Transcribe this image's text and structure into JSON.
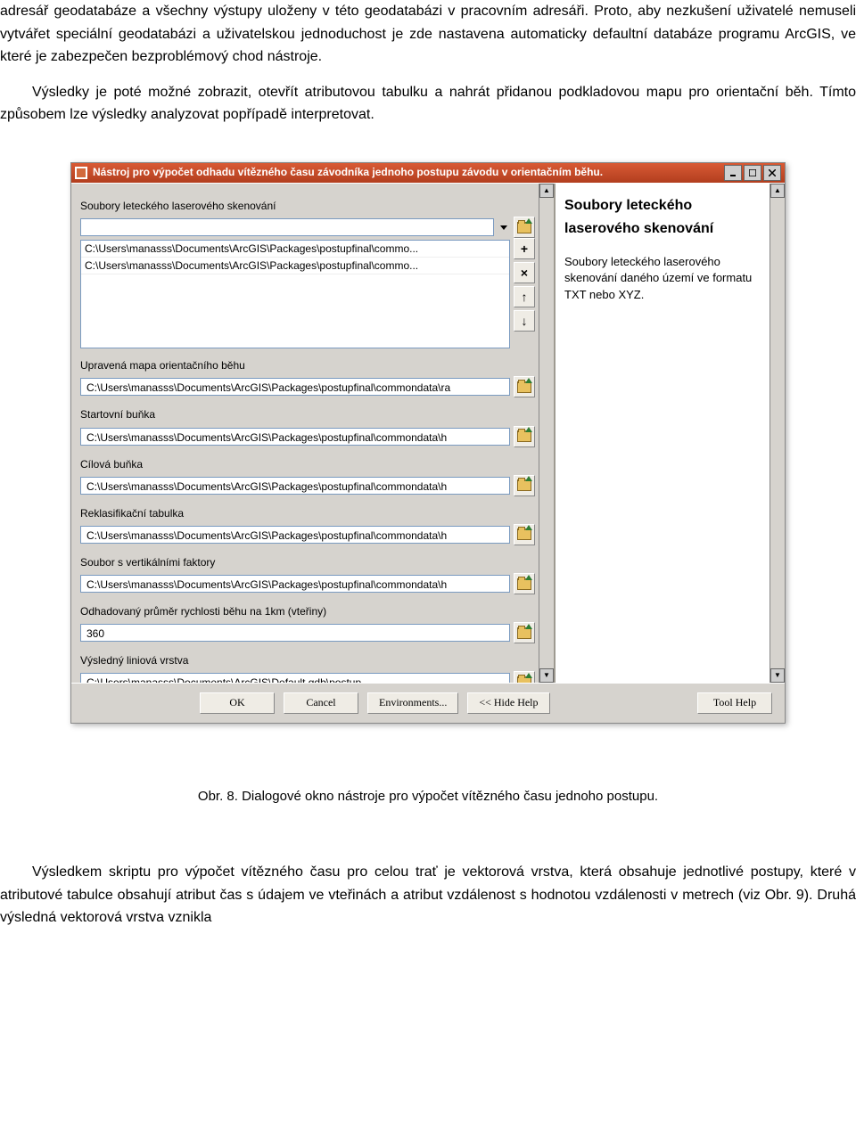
{
  "text": {
    "p1": "adresář geodatabáze a všechny výstupy uloženy v této geodatabázi v pracovním adresáři. Proto, aby nezkušení uživatelé nemuseli vytvářet speciální geodatabázi a uživatelskou jednoduchost je zde nastavena automaticky defaultní databáze programu ArcGIS, ve které je zabezpečen bezproblémový chod nástroje.",
    "p2": "Výsledky je poté možné zobrazit, otevřít atributovou tabulku a nahrát přidanou podkladovou mapu pro orientační běh. Tímto způsobem lze výsledky analyzovat popřípadě interpretovat.",
    "caption": "Obr. 8. Dialogové okno nástroje pro výpočet vítězného času jednoho postupu.",
    "p3": "Výsledkem skriptu pro výpočet vítězného času pro celou trať je vektorová vrstva, která obsahuje jednotlivé postupy, které v atributové tabulce obsahují atribut čas s údajem ve vteřinách a atribut vzdálenost s hodnotou vzdálenosti v metrech (viz Obr. 9). Druhá výsledná vektorová vrstva vznikla"
  },
  "tool": {
    "title": "Nástroj pro výpočet odhadu vítězného času závodníka jednoho postupu závodu v orientačním běhu.",
    "help": {
      "heading": "Soubory leteckého laserového skenování",
      "body": "Soubory leteckého laserového skenování daného území ve formatu TXT nebo XYZ."
    },
    "labels": {
      "lidar": "Soubory leteckého laserového skenování",
      "map": "Upravená mapa orientačního běhu",
      "start": "Startovní buňka",
      "cil": "Cílová buňka",
      "reklas": "Reklasifikační tabulka",
      "vert": "Soubor s vertikálními faktory",
      "speed": "Odhadovaný průměr rychlosti běhu na 1km (vteřiny)",
      "out": "Výsledný liniová vrstva"
    },
    "values": {
      "lidar_input": "",
      "list0": "C:\\Users\\manasss\\Documents\\ArcGIS\\Packages\\postupfinal\\commo...",
      "list1": "C:\\Users\\manasss\\Documents\\ArcGIS\\Packages\\postupfinal\\commo...",
      "map": "C:\\Users\\manasss\\Documents\\ArcGIS\\Packages\\postupfinal\\commondata\\ra",
      "start": "C:\\Users\\manasss\\Documents\\ArcGIS\\Packages\\postupfinal\\commondata\\h",
      "cil": "C:\\Users\\manasss\\Documents\\ArcGIS\\Packages\\postupfinal\\commondata\\h",
      "reklas": "C:\\Users\\manasss\\Documents\\ArcGIS\\Packages\\postupfinal\\commondata\\h",
      "vert": "C:\\Users\\manasss\\Documents\\ArcGIS\\Packages\\postupfinal\\commondata\\h",
      "speed": "360",
      "out": "C:\\Users\\manasss\\Documents\\ArcGIS\\Default.gdb\\postup"
    },
    "buttons": {
      "ok": "OK",
      "cancel": "Cancel",
      "env": "Environments...",
      "hide": "<< Hide Help",
      "toolhelp": "Tool Help"
    }
  }
}
